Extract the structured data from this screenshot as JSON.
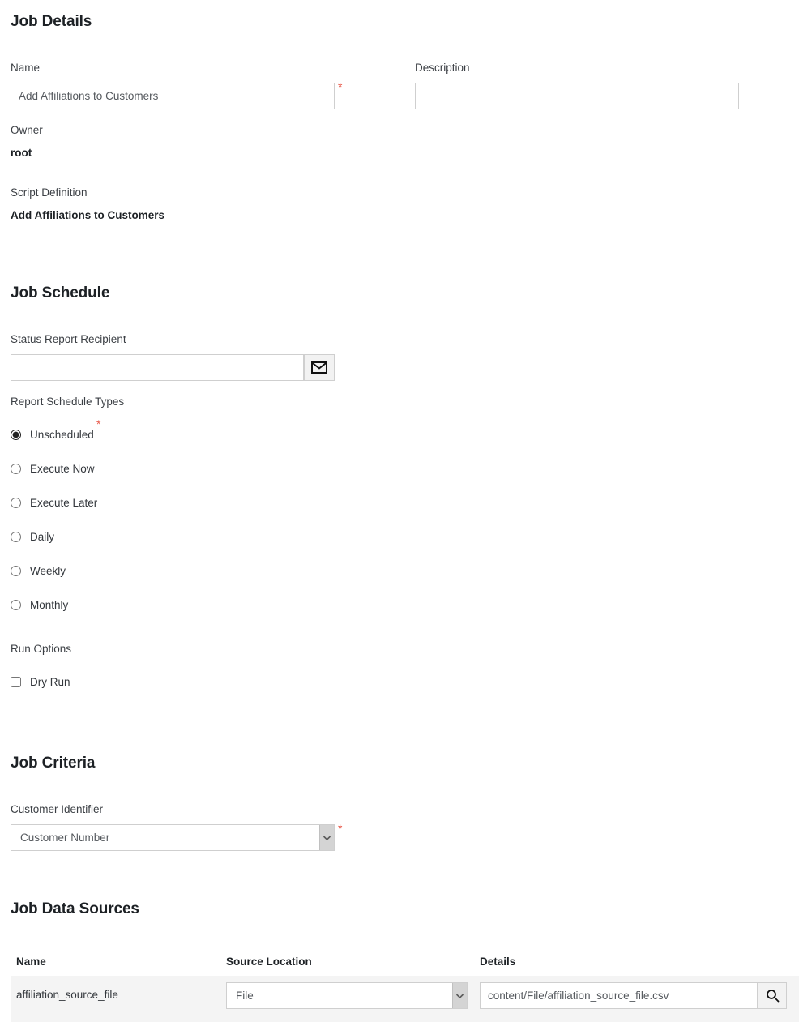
{
  "job_details": {
    "heading": "Job Details",
    "name_label": "Name",
    "name_value": "Add Affiliations to Customers",
    "name_required_marker": "*",
    "description_label": "Description",
    "description_value": "",
    "description_placeholder": "",
    "owner_label": "Owner",
    "owner_value": "root",
    "script_definition_label": "Script Definition",
    "script_definition_value": "Add Affiliations to Customers"
  },
  "job_schedule": {
    "heading": "Job Schedule",
    "status_report_recipient_label": "Status Report Recipient",
    "status_report_recipient_value": "",
    "status_report_recipient_placeholder": "",
    "email_button_icon": "envelope-icon",
    "report_schedule_types_label": "Report Schedule Types",
    "report_schedule_types_required_marker": "*",
    "schedule_options": [
      {
        "label": "Unscheduled",
        "selected": true
      },
      {
        "label": "Execute Now",
        "selected": false
      },
      {
        "label": "Execute Later",
        "selected": false
      },
      {
        "label": "Daily",
        "selected": false
      },
      {
        "label": "Weekly",
        "selected": false
      },
      {
        "label": "Monthly",
        "selected": false
      }
    ],
    "run_options_label": "Run Options",
    "dry_run_label": "Dry Run",
    "dry_run_checked": false
  },
  "job_criteria": {
    "heading": "Job Criteria",
    "customer_identifier_label": "Customer Identifier",
    "customer_identifier_value": "Customer Number",
    "customer_identifier_required_marker": "*",
    "dropdown_icon": "chevron-down-icon"
  },
  "job_data_sources": {
    "heading": "Job Data Sources",
    "columns": [
      "Name",
      "Source Location",
      "Details"
    ],
    "rows": [
      {
        "name": "affiliation_source_file",
        "source_location": "File",
        "details": "content/File/affiliation_source_file.csv",
        "details_browse_icon": "search-icon"
      }
    ]
  },
  "colors": {
    "heading_text": "#1d2125",
    "label_text": "#3b3f44",
    "input_border": "#cfcfcf",
    "required_red": "#e8594a",
    "row_background": "#f4f4f4",
    "button_background": "#f2f2f2"
  }
}
